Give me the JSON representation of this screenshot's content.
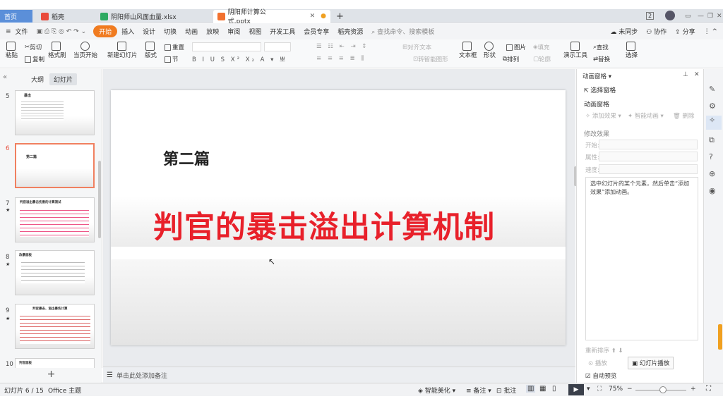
{
  "tabs": [
    {
      "label": "首页"
    },
    {
      "label": "稻壳"
    },
    {
      "label": "阴阳师山风面血量.xlsx"
    },
    {
      "label": "阴阳师计算公式.pptx"
    }
  ],
  "window": {
    "badge": "2"
  },
  "menu": {
    "file": "文件",
    "items": [
      "开始",
      "插入",
      "设计",
      "切换",
      "动画",
      "放映",
      "审阅",
      "视图",
      "开发工具",
      "会员专享",
      "稻壳资源"
    ],
    "search": "查找命令、搜索模板",
    "sync": "未同步",
    "collab": "协作",
    "share": "分享"
  },
  "toolbar": {
    "paste": "粘贴",
    "cut": "剪切",
    "copy": "复制",
    "format_painter": "格式刷",
    "play": "当页开始",
    "new_slide": "新建幻灯片",
    "layout": "版式",
    "section": "节",
    "reset": "重置",
    "align_text": "对齐文本",
    "convert_smartart": "转智能图形",
    "textbox": "文本框",
    "shape": "形状",
    "arrange": "排列",
    "outline": "轮廓",
    "image": "图片",
    "fill": "填充",
    "presenter": "演示工具",
    "find": "查找",
    "replace": "替换",
    "select": "选择"
  },
  "left": {
    "tab_outline": "大纲",
    "tab_slides": "幻灯片",
    "slides": [
      {
        "num": "5",
        "title": "暴击"
      },
      {
        "num": "6",
        "title": "第二篇"
      },
      {
        "num": "7",
        "title": "判官溢出暴击伤害的计算测试"
      },
      {
        "num": "8",
        "title": "改暴面板"
      },
      {
        "num": "9",
        "title": "判官暴击、溢出暴伤计算"
      },
      {
        "num": "10",
        "title": "判官面板"
      }
    ]
  },
  "slide": {
    "heading": "第二篇",
    "title": "判官的暴击溢出计算机制"
  },
  "notes": "单击此处添加备注",
  "anim": {
    "pane_title": "动画窗格",
    "select_pane": "选择窗格",
    "section": "动画窗格",
    "add_effect": "添加效果",
    "smart_anim": "智能动画",
    "delete": "删除",
    "modify": "修改效果",
    "start": "开始:",
    "property": "属性:",
    "speed": "速度:",
    "hint": "选中幻灯片的某个元素，然后单击“添加效果”添加动画。",
    "reorder": "重新排序",
    "play": "播放",
    "slideshow": "幻灯片播放",
    "autopreview": "自动预览"
  },
  "status": {
    "slide_info": "幻灯片 6 / 15",
    "theme": "Office 主题",
    "beautify": "智能美化",
    "notes": "备注",
    "comment": "批注",
    "zoom": "75%"
  }
}
